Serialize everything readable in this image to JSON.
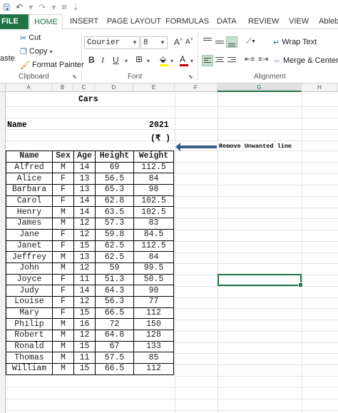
{
  "ribbon": {
    "tabs": [
      "FILE",
      "HOME",
      "INSERT",
      "PAGE LAYOUT",
      "FORMULAS",
      "DATA",
      "REVIEW",
      "VIEW",
      "Ablebi"
    ],
    "clipboard": {
      "paste": "aste",
      "cut": "Cut",
      "copy": "Copy",
      "format_painter": "Format Painter",
      "label": "Clipboard"
    },
    "font": {
      "name": "Courier",
      "size": "8",
      "label": "Font",
      "grow": "A",
      "shrink": "A",
      "bold": "B",
      "italic": "I",
      "underline": "U",
      "color_letter": "A",
      "fill_color": "#ffff00",
      "font_color": "#c00000"
    },
    "alignment": {
      "wrap": "Wrap Text",
      "merge": "Merge & Center",
      "label": "Alignment"
    }
  },
  "columns": [
    "A",
    "B",
    "C",
    "D",
    "E",
    "F",
    "G",
    "H"
  ],
  "selected_column": "G",
  "sheet": {
    "title": "Cars",
    "name_label": "Name",
    "year": "2021",
    "currency": "(₹ )",
    "note": "Remove Unwanted line",
    "headers": [
      "Name",
      "Sex",
      "Age",
      "Height",
      "Weight"
    ],
    "rows": [
      [
        "Alfred",
        "M",
        "14",
        "69",
        "112.5"
      ],
      [
        "Alice",
        "F",
        "13",
        "56.5",
        "84"
      ],
      [
        "Barbara",
        "F",
        "13",
        "65.3",
        "98"
      ],
      [
        "Carol",
        "F",
        "14",
        "62.8",
        "102.5"
      ],
      [
        "Henry",
        "M",
        "14",
        "63.5",
        "102.5"
      ],
      [
        "James",
        "M",
        "12",
        "57.3",
        "83"
      ],
      [
        "Jane",
        "F",
        "12",
        "59.8",
        "84.5"
      ],
      [
        "Janet",
        "F",
        "15",
        "62.5",
        "112.5"
      ],
      [
        "Jeffrey",
        "M",
        "13",
        "62.5",
        "84"
      ],
      [
        "John",
        "M",
        "12",
        "59",
        "99.5"
      ],
      [
        "Joyce",
        "F",
        "11",
        "51.3",
        "50.5"
      ],
      [
        "Judy",
        "F",
        "14",
        "64.3",
        "90"
      ],
      [
        "Louise",
        "F",
        "12",
        "56.3",
        "77"
      ],
      [
        "Mary",
        "F",
        "15",
        "66.5",
        "112"
      ],
      [
        "Philip",
        "M",
        "16",
        "72",
        "150"
      ],
      [
        "Robert",
        "M",
        "12",
        "64.8",
        "128"
      ],
      [
        "Ronald",
        "M",
        "15",
        "67",
        "133"
      ],
      [
        "Thomas",
        "M",
        "11",
        "57.5",
        "85"
      ],
      [
        "William",
        "M",
        "15",
        "66.5",
        "112"
      ]
    ]
  },
  "colors": {
    "accent": "#217346",
    "arrow": "#3b5e8a"
  }
}
